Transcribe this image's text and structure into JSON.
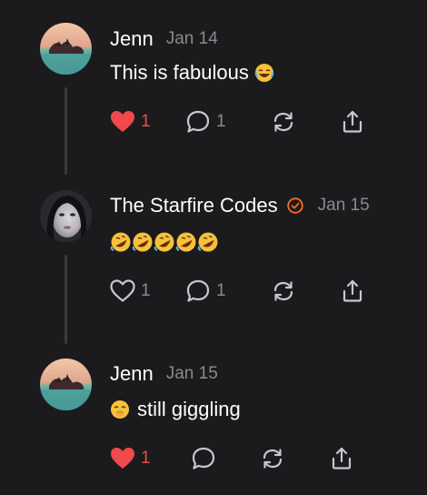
{
  "comments": [
    {
      "author": "Jenn",
      "date": "Jan 14",
      "text": "This is fabulous",
      "emoji": "laughing-with-tears-emoji",
      "liked": true,
      "like_count": "1",
      "reply_count": "1"
    },
    {
      "author": "The Starfire Codes",
      "date": "Jan 15",
      "verified": true,
      "text": "",
      "emoji": "rolling-on-floor-laughing-emoji x5",
      "liked": false,
      "like_count": "1",
      "reply_count": "1"
    },
    {
      "author": "Jenn",
      "date": "Jan 15",
      "text": "still giggling",
      "emoji": "giggling-face-emoji",
      "liked": true,
      "like_count": "1",
      "reply_count": ""
    }
  ],
  "colors": {
    "background": "#1b1b1d",
    "liked": "#f04a4c",
    "muted": "#8a8a8e",
    "verified": "#f5701f"
  }
}
